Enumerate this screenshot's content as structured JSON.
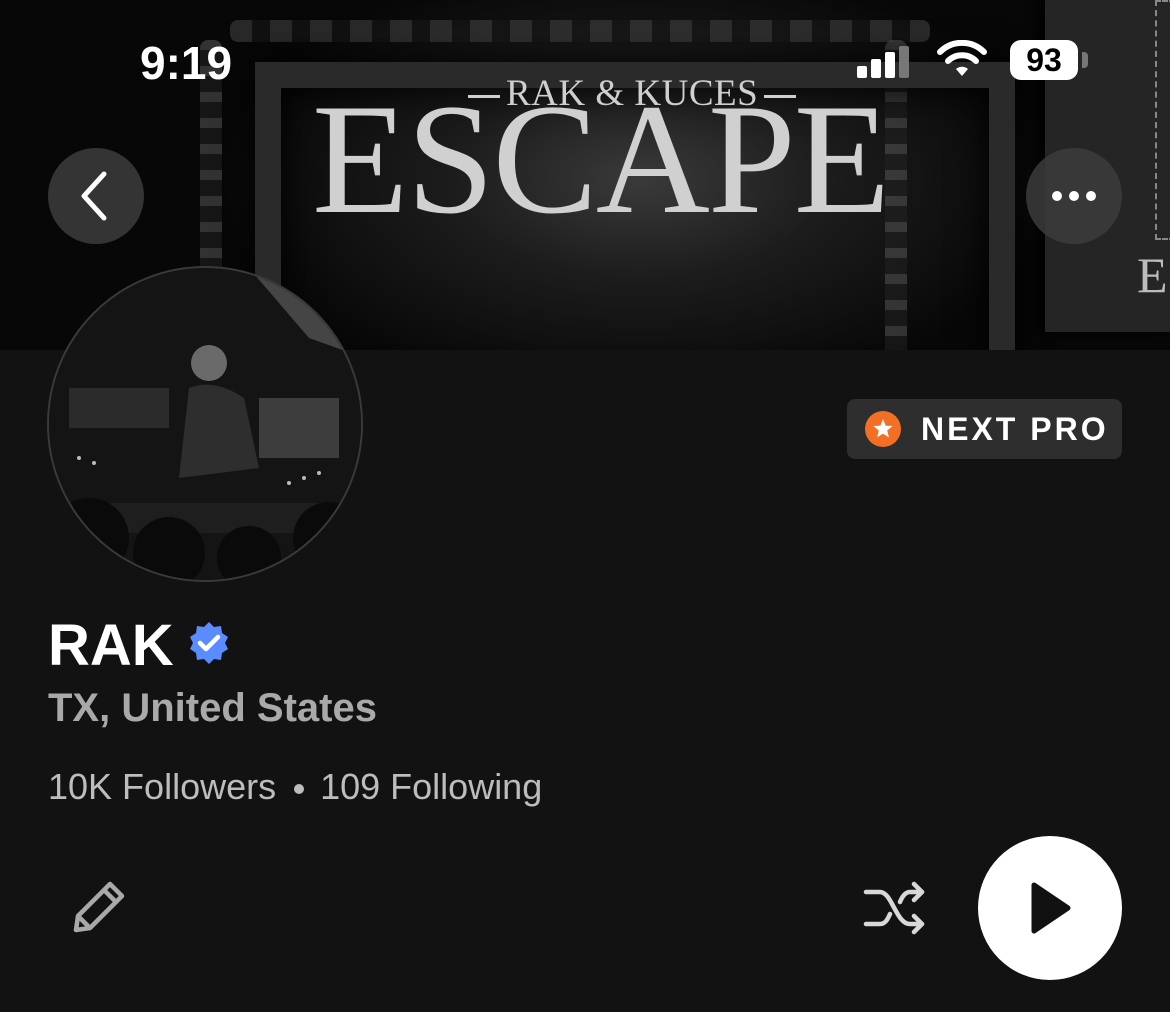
{
  "status_bar": {
    "time": "9:19",
    "battery": "93"
  },
  "header": {
    "banner_subtitle": "RAK & KUCES",
    "banner_title": "ESCAPE",
    "poster_letter": "E",
    "back_icon": "chevron-left-icon",
    "more_icon": "ellipsis-icon"
  },
  "badge": {
    "label": "NEXT PRO",
    "icon": "star-icon",
    "color": "#f26f23"
  },
  "profile": {
    "name": "RAK",
    "verified_color": "#5b8cff",
    "location": "TX, United States",
    "followers": "10K Followers",
    "following": "109 Following"
  },
  "actions": {
    "edit_icon": "pencil-icon",
    "shuffle_icon": "shuffle-icon",
    "play_icon": "play-icon"
  }
}
